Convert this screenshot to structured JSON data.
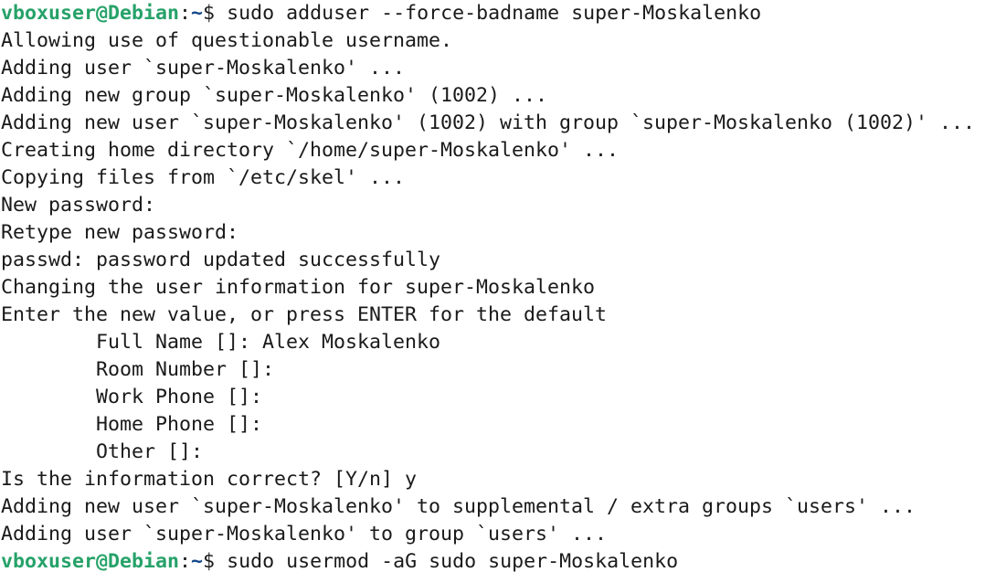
{
  "colors": {
    "background": "#ffffff",
    "text": "#1a1a1a",
    "prompt_user": "#26a269",
    "prompt_path": "#12488b"
  },
  "prompt1": {
    "user_host": "vboxuser@Debian",
    "sep": ":",
    "path": "~",
    "symbol": "$ ",
    "command": "sudo adduser --force-badname super-Moskalenko"
  },
  "output": [
    "Allowing use of questionable username.",
    "Adding user `super-Moskalenko' ...",
    "Adding new group `super-Moskalenko' (1002) ...",
    "Adding new user `super-Moskalenko' (1002) with group `super-Moskalenko (1002)' ...",
    "Creating home directory `/home/super-Moskalenko' ...",
    "Copying files from `/etc/skel' ...",
    "New password:",
    "Retype new password:",
    "passwd: password updated successfully",
    "Changing the user information for super-Moskalenko",
    "Enter the new value, or press ENTER for the default",
    "        Full Name []: Alex Moskalenko",
    "        Room Number []:",
    "        Work Phone []:",
    "        Home Phone []:",
    "        Other []:",
    "Is the information correct? [Y/n] y",
    "Adding new user `super-Moskalenko' to supplemental / extra groups `users' ...",
    "Adding user `super-Moskalenko' to group `users' ..."
  ],
  "prompt2": {
    "user_host": "vboxuser@Debian",
    "sep": ":",
    "path": "~",
    "symbol": "$ ",
    "command": "sudo usermod -aG sudo super-Moskalenko"
  }
}
